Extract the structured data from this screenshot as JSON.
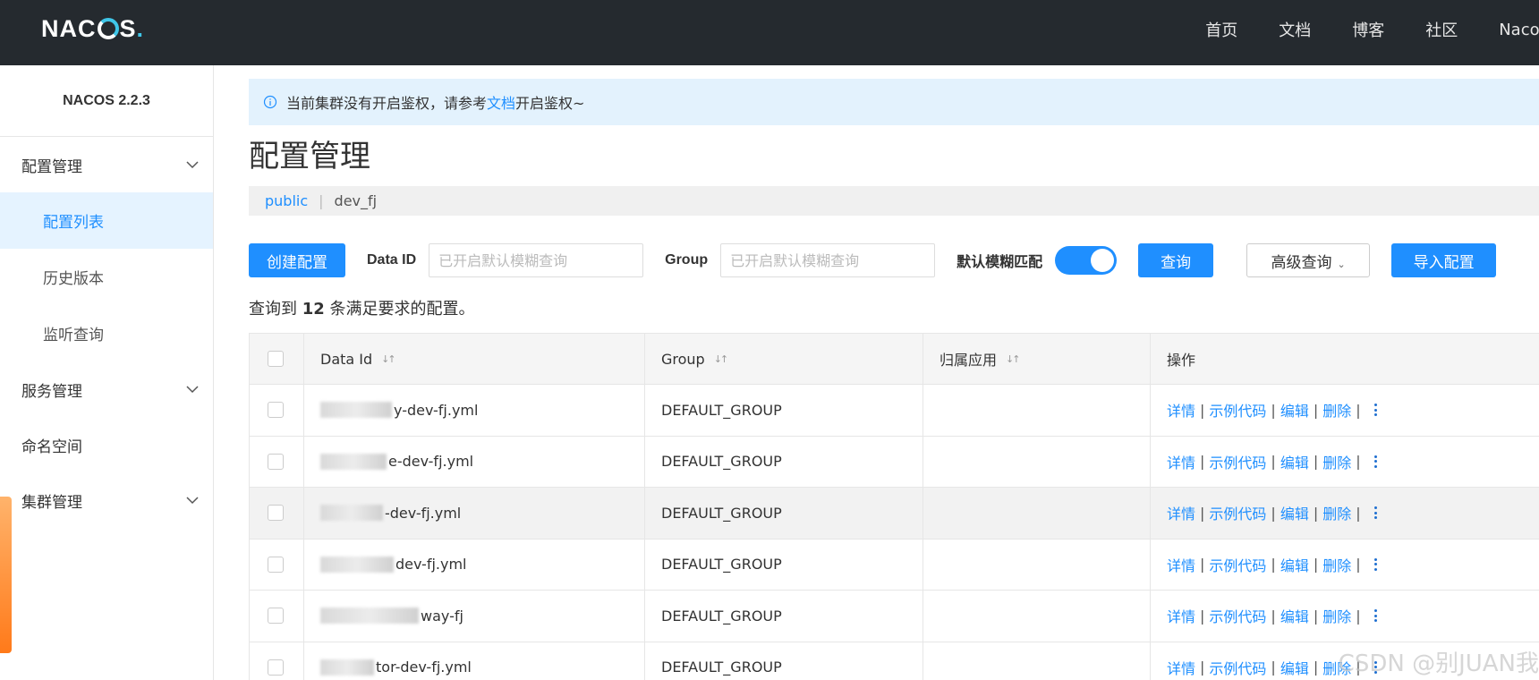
{
  "header": {
    "logo_text": "NACOS",
    "nav": [
      "首页",
      "文档",
      "博客",
      "社区",
      "Nacos"
    ]
  },
  "sidebar": {
    "version": "NACOS 2.2.3",
    "groups": [
      {
        "label": "配置管理",
        "items": [
          "配置列表",
          "历史版本",
          "监听查询"
        ]
      },
      {
        "label": "服务管理"
      },
      {
        "label": "命名空间"
      },
      {
        "label": "集群管理"
      }
    ]
  },
  "alert": {
    "prefix": "当前集群没有开启鉴权，请参考",
    "link": "文档",
    "suffix": "开启鉴权~"
  },
  "page_title": "配置管理",
  "breadcrumb": {
    "namespace": "public",
    "separator": "|",
    "current": "dev_fj"
  },
  "toolbar": {
    "create_label": "创建配置",
    "dataid_label": "Data ID",
    "dataid_placeholder": "已开启默认模糊查询",
    "group_label": "Group",
    "group_placeholder": "已开启默认模糊查询",
    "fuzzy_label": "默认模糊匹配",
    "fuzzy_enabled": true,
    "query_label": "查询",
    "advanced_label": "高级查询",
    "import_label": "导入配置"
  },
  "result": {
    "prefix": "查询到",
    "count": "12",
    "suffix": "条满足要求的配置。"
  },
  "table": {
    "columns": [
      "Data Id",
      "Group",
      "归属应用",
      "操作"
    ],
    "rows": [
      {
        "data_id": "y-dev-fj.yml",
        "group": "DEFAULT_GROUP",
        "app": ""
      },
      {
        "data_id": "e-dev-fj.yml",
        "group": "DEFAULT_GROUP",
        "app": ""
      },
      {
        "data_id": "-dev-fj.yml",
        "group": "DEFAULT_GROUP",
        "app": ""
      },
      {
        "data_id": "dev-fj.yml",
        "group": "DEFAULT_GROUP",
        "app": ""
      },
      {
        "data_id": "way-fj",
        "group": "DEFAULT_GROUP",
        "app": ""
      },
      {
        "data_id": "tor-dev-fj.yml",
        "group": "DEFAULT_GROUP",
        "app": ""
      }
    ],
    "actions": [
      "详情",
      "示例代码",
      "编辑",
      "删除"
    ]
  },
  "watermark": "CSDN @别JUAN我",
  "colors": {
    "accent": "#1f8fff",
    "header_bg": "#252a2f",
    "active_menu_bg": "#e5f3ff"
  }
}
